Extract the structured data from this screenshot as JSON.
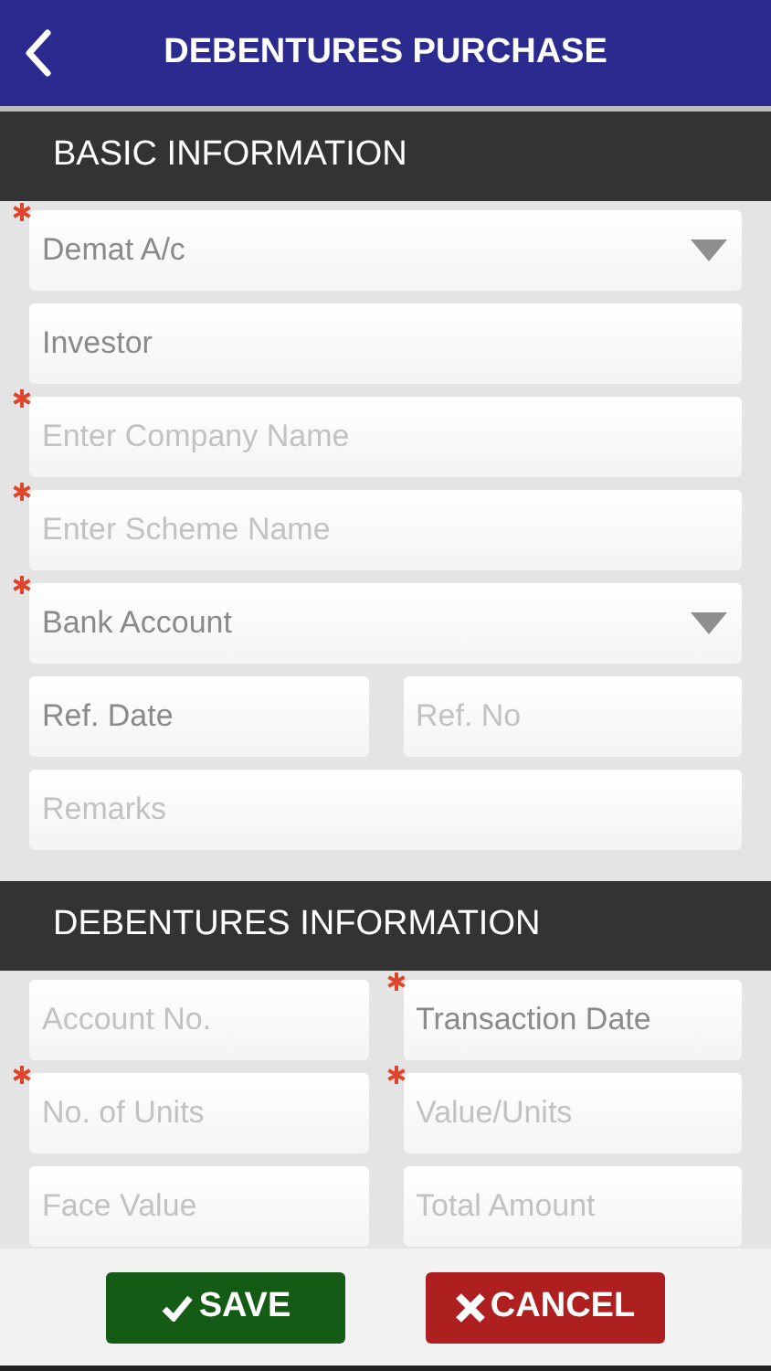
{
  "header": {
    "title": "DEBENTURES PURCHASE"
  },
  "sections": [
    {
      "title": "BASIC INFORMATION",
      "rows": [
        [
          {
            "kind": "select",
            "value": "Demat A/c",
            "required": true
          }
        ],
        [
          {
            "kind": "text",
            "value": "Investor",
            "required": false
          }
        ],
        [
          {
            "kind": "text",
            "placeholder": "Enter Company Name",
            "required": true
          }
        ],
        [
          {
            "kind": "text",
            "placeholder": "Enter Scheme Name",
            "required": true
          }
        ],
        [
          {
            "kind": "select",
            "value": "Bank Account",
            "required": true
          }
        ],
        [
          {
            "kind": "text",
            "value": "Ref. Date",
            "required": false
          },
          {
            "kind": "text",
            "placeholder": "Ref. No",
            "required": false
          }
        ],
        [
          {
            "kind": "text",
            "placeholder": "Remarks",
            "required": false
          }
        ]
      ]
    },
    {
      "title": "DEBENTURES INFORMATION",
      "rows": [
        [
          {
            "kind": "text",
            "placeholder": "Account No.",
            "required": false
          },
          {
            "kind": "text",
            "value": "Transaction Date",
            "required": true
          }
        ],
        [
          {
            "kind": "text",
            "placeholder": "No. of Units",
            "required": true
          },
          {
            "kind": "text",
            "placeholder": "Value/Units",
            "required": true
          }
        ],
        [
          {
            "kind": "text",
            "placeholder": "Face Value",
            "required": false
          },
          {
            "kind": "text",
            "placeholder": "Total Amount",
            "required": false
          }
        ]
      ]
    }
  ],
  "buttons": [
    {
      "kind": "save",
      "label": "SAVE"
    },
    {
      "kind": "cancel",
      "label": "CANCEL"
    }
  ]
}
